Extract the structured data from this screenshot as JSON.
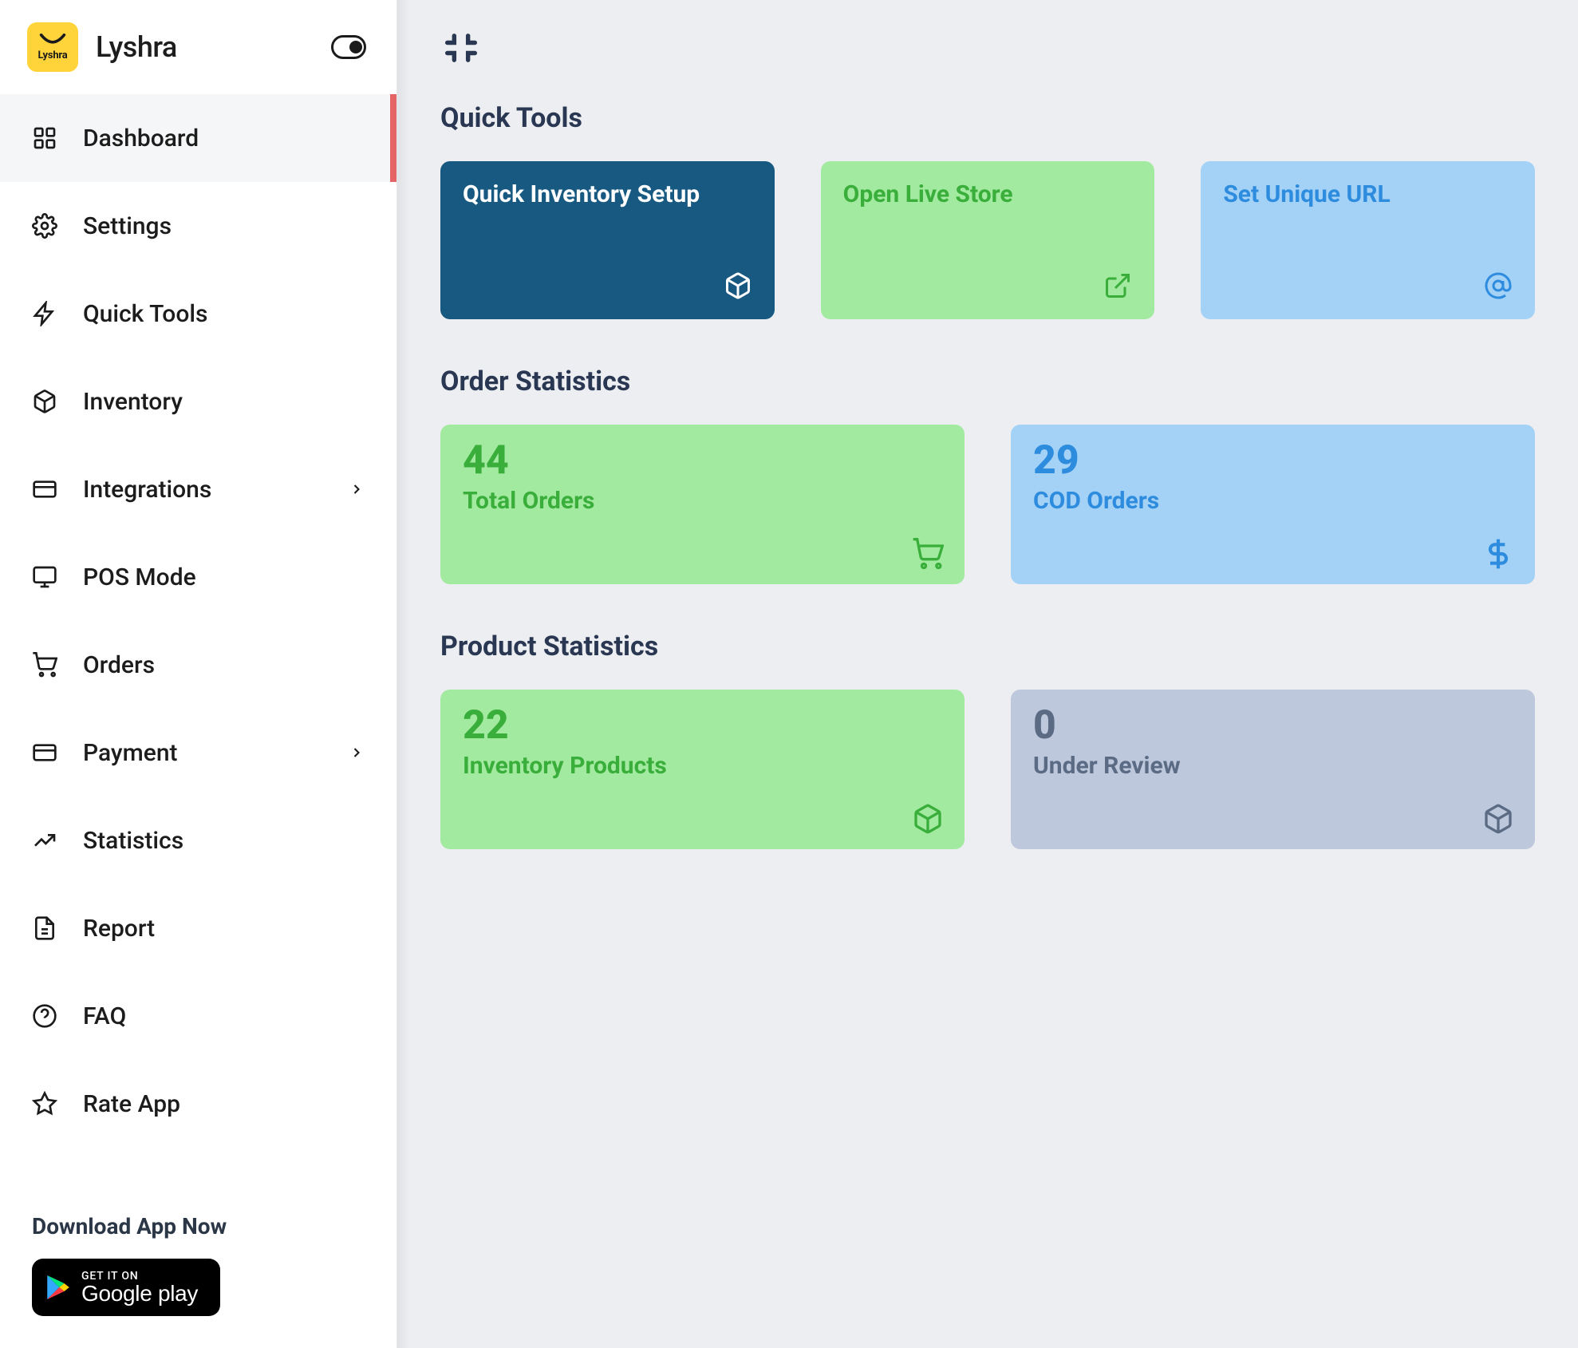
{
  "brand": {
    "name": "Lyshra",
    "badge_word": "Lyshra"
  },
  "sidebar": {
    "items": [
      {
        "label": "Dashboard",
        "icon": "grid",
        "active": true
      },
      {
        "label": "Settings",
        "icon": "gear"
      },
      {
        "label": "Quick Tools",
        "icon": "bolt"
      },
      {
        "label": "Inventory",
        "icon": "box"
      },
      {
        "label": "Integrations",
        "icon": "card",
        "chevron": true
      },
      {
        "label": "POS Mode",
        "icon": "monitor"
      },
      {
        "label": "Orders",
        "icon": "cart"
      },
      {
        "label": "Payment",
        "icon": "card",
        "chevron": true
      },
      {
        "label": "Statistics",
        "icon": "trend"
      },
      {
        "label": "Report",
        "icon": "file"
      },
      {
        "label": "FAQ",
        "icon": "help"
      },
      {
        "label": "Rate App",
        "icon": "star"
      }
    ]
  },
  "promo": {
    "title": "Download App Now",
    "gplay_small": "GET IT ON",
    "gplay_big": "Google play"
  },
  "sections": {
    "quick_tools": {
      "title": "Quick Tools",
      "cards": [
        {
          "title": "Quick Inventory Setup",
          "icon": "box",
          "variant": "navy"
        },
        {
          "title": "Open Live Store",
          "icon": "external",
          "variant": "green"
        },
        {
          "title": "Set Unique URL",
          "icon": "at",
          "variant": "blue"
        }
      ]
    },
    "order_stats": {
      "title": "Order Statistics",
      "cards": [
        {
          "value": "44",
          "label": "Total Orders",
          "icon": "cart",
          "variant": "green"
        },
        {
          "value": "29",
          "label": "COD Orders",
          "icon": "dollar",
          "variant": "blue"
        }
      ]
    },
    "product_stats": {
      "title": "Product Statistics",
      "cards": [
        {
          "value": "22",
          "label": "Inventory Products",
          "icon": "box",
          "variant": "green"
        },
        {
          "value": "0",
          "label": "Under Review",
          "icon": "box",
          "variant": "gray"
        }
      ]
    }
  }
}
